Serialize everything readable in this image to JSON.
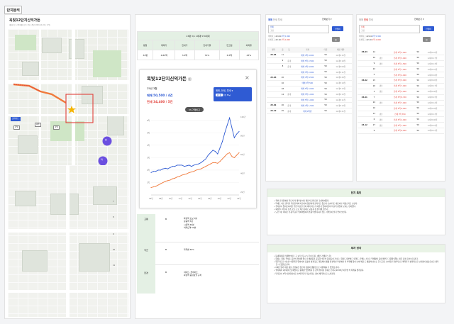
{
  "page": {
    "title": "단지분석"
  },
  "complex": {
    "name": "옥빛12단지신익가든",
    "meta": "세대수 | 1,134세대 | 동 1동 | 준공 1991.11.01 | 17층"
  },
  "map": {
    "labels": [
      "롯데마트",
      "대주",
      "옥빛",
      "한빛"
    ],
    "blue_pins": [
      "효",
      "마"
    ],
    "numbers": [
      "7",
      "8",
      "9",
      "10",
      "11"
    ]
  },
  "summary_table": {
    "title": "23평 3/1 1세대 570세대",
    "headers": [
      "평형",
      "매매가",
      "전세가",
      "전세가율",
      "전고점",
      "하락율"
    ],
    "row": [
      "32평",
      "4.89억",
      "3.6억",
      "74%",
      "6.5억",
      "43%"
    ]
  },
  "chart_card": {
    "title": "옥빛12단지신익가든",
    "date": "25년 3월",
    "price_sale": "매매 50,500 / 4건",
    "price_rent": "전세 34,400 / 5건",
    "filter": "매매, 전세, 월세",
    "filter_sub": "23평",
    "filter_sub2": "전용 59㎡",
    "vs_button": "VS 거래비교"
  },
  "chart_data": {
    "type": "line",
    "x_ticks": [
      "06년",
      "08년",
      "10년",
      "12년",
      "14년",
      "16년",
      "18년",
      "20년",
      "22년",
      "24년"
    ],
    "left_ticks": [
      "6억",
      "5억",
      "4억",
      "3억",
      "2억",
      "1억"
    ],
    "right_ticks": [
      "100건",
      "80건",
      "60건",
      "40건",
      "20건"
    ],
    "ylim": [
      0,
      6.5
    ],
    "series": [
      {
        "color": "#2f5bd3",
        "values": [
          1.8,
          1.9,
          1.9,
          2.0,
          2.0,
          2.1,
          2.15,
          2.1,
          2.2,
          2.3,
          2.3,
          2.4,
          2.4,
          2.4,
          2.3,
          2.35,
          2.4,
          2.3,
          2.4,
          2.45,
          2.5,
          2.6,
          2.75,
          2.9,
          3.2,
          3.4,
          3.6,
          3.5,
          3.3,
          3.8,
          4.3,
          5.0,
          5.6,
          6.2,
          5.4,
          4.6,
          4.9,
          5.1
        ]
      },
      {
        "color": "#f07a3c",
        "values": [
          0.6,
          0.65,
          0.7,
          0.8,
          0.9,
          1.0,
          1.1,
          1.15,
          1.2,
          1.3,
          1.35,
          1.45,
          1.5,
          1.6,
          1.65,
          1.7,
          1.8,
          1.85,
          1.9,
          2.0,
          2.05,
          2.1,
          2.2,
          2.3,
          2.4,
          2.5,
          2.6,
          2.6,
          2.55,
          2.7,
          2.9,
          3.1,
          3.3,
          3.4,
          3.1,
          3.0,
          3.2,
          3.4
        ]
      }
    ]
  },
  "info_rows": [
    {
      "category": "교통",
      "grade": "B",
      "lines": [
        "화정역 도보 3분",
        "삼송역 5정",
        "시청역 40분",
        "여의도역 50분"
      ]
    },
    {
      "category": "학군",
      "grade": "B",
      "lines": [
        "학력률 64%"
      ]
    },
    {
      "category": "환경",
      "grade": "B",
      "lines": [
        "이마트, 롯데마트",
        "화정역 중심상권 근처"
      ]
    }
  ],
  "trade_left": {
    "tabs": [
      "매매",
      "전세",
      "월세"
    ],
    "dropdown": "전체보기",
    "period_label": "전체",
    "period_sub": "고점",
    "button": "전월비",
    "summary": [
      {
        "k": "매매최고",
        "date": "22.04",
        "v": "6억 5,300"
      },
      {
        "k": "전세최고",
        "date": "22.10",
        "v": "4억 2,000"
      }
    ],
    "cols": [
      "계약",
      "층",
      "동",
      "거래",
      "타입",
      "매물·계약"
    ],
    "rows": [
      [
        "25.04",
        "11",
        "",
        "매매 4억 9,000",
        "59",
        "12대8 15일"
      ],
      [
        "",
        "9",
        "중개",
        "매매 5억 2,500",
        "59",
        "12대8 19일"
      ],
      [
        "",
        "8",
        "중개",
        "매매 4억 9,000",
        "59",
        "12대8 09일"
      ],
      [
        "",
        "",
        "",
        "매매 5억 2,000",
        "59",
        "12대8 11일"
      ],
      [
        "25.03",
        "20",
        "",
        "매매 4억 8,500",
        "59",
        "12대8 29일"
      ],
      [
        "",
        "10",
        "",
        "매매 5억 500",
        "59",
        "12대8 14일"
      ],
      [
        "",
        "18",
        "",
        "매매 5억 2,000",
        "59",
        "12대8 13일"
      ],
      [
        "",
        "14",
        "중개",
        "매매 5억 1,000",
        "59",
        "12대8 13일"
      ],
      [
        "",
        "",
        "",
        "매매 5억 1,000",
        "59",
        "12대8 11일"
      ],
      [
        "25.01",
        "20",
        "중개",
        "매매 4억 1,500",
        "59",
        "12대8 13일"
      ],
      [
        "24.12",
        "25",
        "중개",
        "매매 4억원",
        "59",
        "12대8 21일"
      ]
    ]
  },
  "trade_right": {
    "tabs": [
      "매매",
      "전세",
      "월세"
    ],
    "dropdown": "전체보기",
    "period_label": "전체",
    "period_sub": "고점",
    "button": "전월비",
    "summary": [
      {
        "k": "매매최고",
        "date": "22.04",
        "v": "6억 5,300"
      },
      {
        "k": "전세최고",
        "date": "22.10",
        "v": "4억 2,000"
      }
    ],
    "rows": [
      [
        "25.04",
        "14",
        "",
        "전세 3억 5,000",
        "59",
        "12대8 16일"
      ],
      [
        "",
        "10",
        "갱신",
        "전세 3억 5,000",
        "59",
        "12대8 17일"
      ],
      [
        "",
        "9",
        "갱신",
        "전세 3억 1,500",
        "59",
        "12대8 13일"
      ],
      [
        "",
        "22",
        "",
        "전세 3억 7,000",
        "59",
        "12대8 10일"
      ],
      [
        "",
        "5",
        "",
        "전세 3억 4,000",
        "59",
        "12대8 04일"
      ],
      [
        "25.02",
        "15",
        "",
        "전세 3억 5,000",
        "59",
        "12대8 26일"
      ],
      [
        "",
        "20",
        "갱신",
        "전세 3억 7,000",
        "59",
        "12대8 17일"
      ],
      [
        "",
        "3",
        "갱신",
        "전세 3억 3,000",
        "59",
        "12대8 06일"
      ],
      [
        "25.01",
        "7",
        "",
        "전세 3억 8,700",
        "59",
        "12대8 23일"
      ],
      [
        "",
        "24",
        "갱신",
        "전세 3억 7,000",
        "59",
        "12대8 12일"
      ],
      [
        "",
        "10",
        "",
        "전세 3억 8,000",
        "59",
        "12대8 09일"
      ],
      [
        "",
        "13",
        "갱신",
        "전세 3억 350",
        "59",
        "12대8 13일"
      ],
      [
        "",
        "6",
        "갱신",
        "전세 3억 4,000",
        "59",
        "12대8 06일"
      ],
      [
        "24.12",
        "27",
        "갱신",
        "전세 3억 7,000",
        "59",
        "12대8 03일"
      ],
      [
        "",
        "9",
        "",
        "전세 3억 8,000",
        "59",
        "12대8 12일"
      ]
    ]
  },
  "features": {
    "title": "단지 특징",
    "items": [
      "주변 단지들에서 학도의 미 대부분이나 계단식 단지로만 구성하여있다.",
      "역세도 외로 걸리가 주변단지와 비교하여 합판하게 관리되고 있으며, 놀이터도 새로이나 지점으되고 보인다.",
      "주차난이 있어보이지만 주변 비슷한 단지 대비 차도가 여유가 있어서인지 비교적 괜찮아 보이는 편이었다.",
      "화장실, 어린이, 삼초 모두 도보 3분 이내로 교통과 정 편리해 보인다.",
      "도보 3분 이내로 초,중학교가 위치해있어서 초중학생 자녀가 있는 가족들이 살기 좋아 보인다."
    ]
  },
  "investment": {
    "title": "투자 생각",
    "items": [
      "동네최하층 전세확인이로 구 1기 신도시 노후이 단지, (해민 긴해된 노후)",
      "화정는 화정, 역세는 뭉신의 위치해 있으나 생활동을 공동할 수준의 동네동어 거나으. 화정도 대부에 그린행도, 우해는 신으로 역채없어 동네 해부가 고령화되었는 점은 감점 요소보다 같다.",
      "업무지도로 서소면 수원우을 업어여서 김포와 쉽게 동도 행동에서 생활 환경적인 부분에서 더 부위에 있어 보여 해당 도 생활의 선호는 할 도요로 보이지만 전반적으로 매력가가 상대적으로 보인점이 상승요소로 생각할 수 있을것 같다.",
      "아파트맨기 대상 중분 소유를은 청신과 심중과 생활편으로 지원해를 수 있을것 같다.",
      "행복에서 내리하게 및 제방되고 중에선 않을케너 분 갑의 취어된 호재로 보이니 2030년 이후엔 의 미래를 생각된다.",
      "투자금이 1억 이런대사이로 소액투자가 가능하다는 점이 매려적으로 느껴진다."
    ]
  },
  "colors": {
    "accent": "#2f5bd3",
    "red": "#e2423b",
    "orange": "#f07a3c",
    "green_header": "#e4f0e4"
  }
}
